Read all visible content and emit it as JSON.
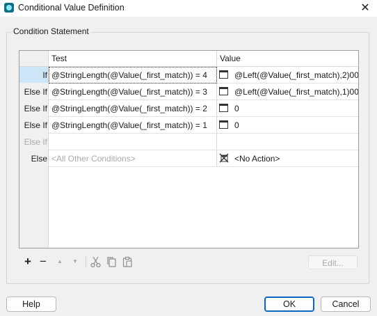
{
  "window": {
    "title": "Conditional Value Definition",
    "close_glyph": "✕"
  },
  "group": {
    "legend": "Condition Statement"
  },
  "grid": {
    "columns": {
      "test": "Test",
      "value": "Value"
    },
    "rows": [
      {
        "label": "If",
        "test": "@StringLength(@Value(_first_match)) = 4",
        "value": "@Left(@Value(_first_match),2)00",
        "icon": "value-expression-icon"
      },
      {
        "label": "Else If",
        "test": "@StringLength(@Value(_first_match)) = 3",
        "value": "@Left(@Value(_first_match),1)00",
        "icon": "value-expression-icon"
      },
      {
        "label": "Else If",
        "test": "@StringLength(@Value(_first_match)) = 2",
        "value": "0",
        "icon": "value-expression-icon"
      },
      {
        "label": "Else If",
        "test": "@StringLength(@Value(_first_match)) = 1",
        "value": "0",
        "icon": "value-expression-icon"
      },
      {
        "label": "Else If",
        "test": "",
        "value": "",
        "icon": ""
      },
      {
        "label": "Else",
        "test": "<All Other Conditions>",
        "value": "<No Action>",
        "icon": "no-action-icon"
      }
    ]
  },
  "toolbar": {
    "add_glyph": "+",
    "remove_glyph": "−",
    "up_glyph": "▲",
    "down_glyph": "▼",
    "edit_label": "Edit..."
  },
  "buttons": {
    "help": "Help",
    "ok": "OK",
    "cancel": "Cancel"
  },
  "colors": {
    "selection": "#cde6f7",
    "primary_border": "#0a66c2"
  }
}
